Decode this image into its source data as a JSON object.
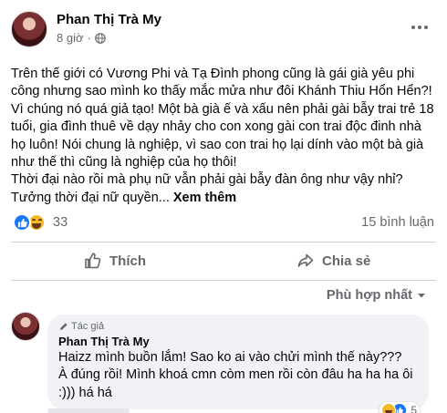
{
  "post": {
    "author": "Phan Thị Trà My",
    "time": "8 giờ",
    "paragraph_1": "Trên thế giới có Vương Phi và Tạ Đình phong cũng là gái già yêu phi công nhưng sao mình ko thấy mắc mửa như đôi Khánh Thiu Hổn Hển?! Vì chúng nó quá giả tạo! Một bà già ế và xấu nên phải gài bẫy trai trẻ 18 tuổi, gia đình thuê về dạy nhảy cho con xong gài con trai độc đinh nhà họ luôn! Nói chung là nghiệp, vì sao con trai họ lại dính vào một bà già như thế thì cũng là nghiệp của họ thôi!",
    "paragraph_2": "Thời đại nào rồi mà phụ nữ vẫn phải gài bẫy đàn ông như vậy nhỉ? Tưởng thời đại nữ quyền...",
    "see_more": "Xem thêm",
    "reaction_count": "33",
    "comment_count": "15 bình luận"
  },
  "actions": {
    "like": "Thích",
    "share": "Chia sẻ"
  },
  "sort_label": "Phù hợp nhất",
  "comment": {
    "badge": "Tác giả",
    "author": "Phan Thị Trà My",
    "text": "Haizz mình buồn lắm! Sao ko ai vào chửi mình thế này???\nÀ đúng rồi! Mình khoá cmn còm men rồi còn đâu ha ha ha ôi :))) há há",
    "reaction_count": "5"
  },
  "colors": {
    "like_blue": "#1877f2",
    "haha_yellow": "#f7b928",
    "secondary_text": "#65676b",
    "comment_bubble": "#f0f2f5"
  }
}
